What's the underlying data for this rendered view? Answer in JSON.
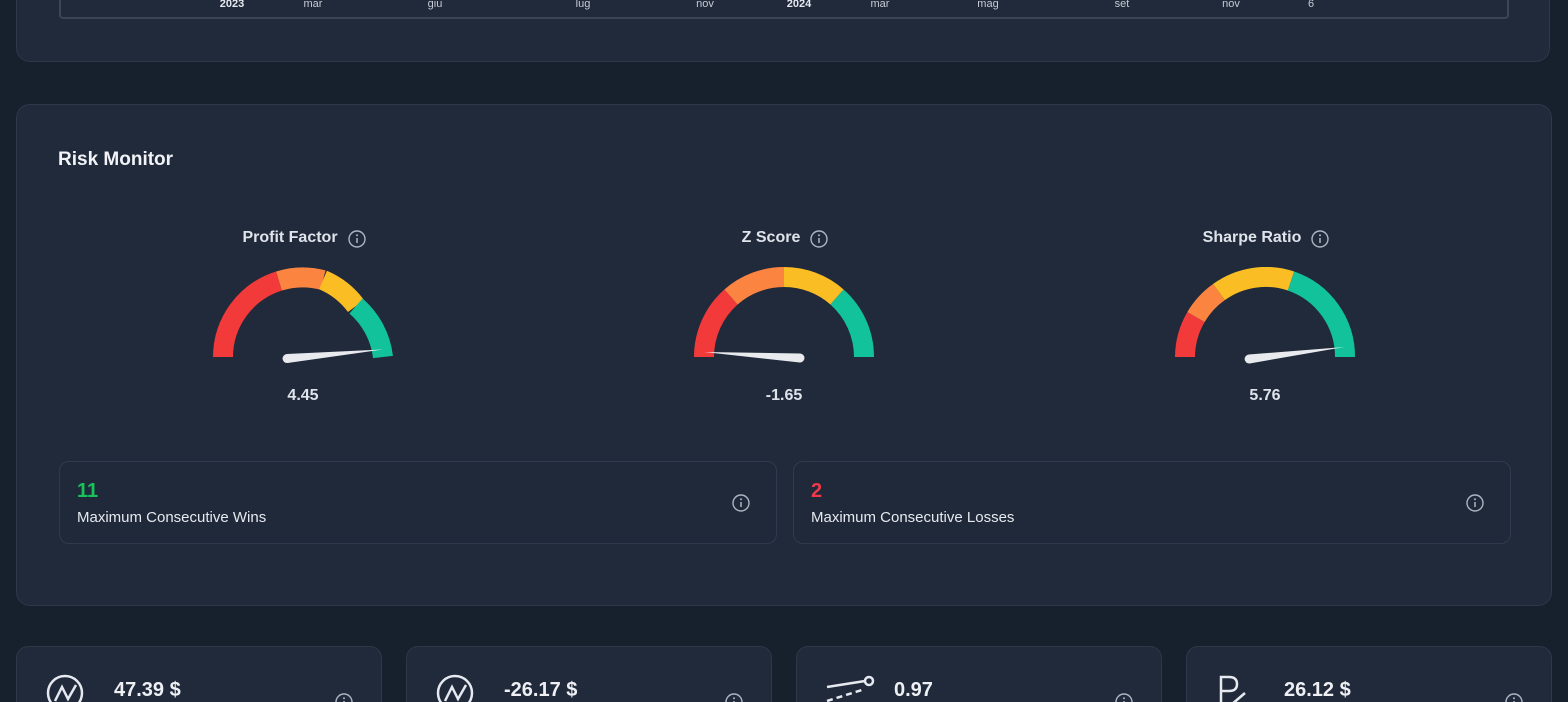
{
  "timeline": {
    "ticks": [
      {
        "label": "2023",
        "bold": true
      },
      {
        "label": "mar",
        "bold": false
      },
      {
        "label": "giu",
        "bold": false
      },
      {
        "label": "lug",
        "bold": false
      },
      {
        "label": "nov",
        "bold": false
      },
      {
        "label": "2024",
        "bold": true
      },
      {
        "label": "mar",
        "bold": false
      },
      {
        "label": "mag",
        "bold": false
      },
      {
        "label": "set",
        "bold": false
      },
      {
        "label": "nov",
        "bold": false
      },
      {
        "label": "6",
        "bold": false
      }
    ]
  },
  "risk_monitor": {
    "title": "Risk Monitor",
    "gauges": [
      {
        "label": "Profit Factor",
        "value": "4.45",
        "needle_fraction": 0.97
      },
      {
        "label": "Z Score",
        "value": "-1.65",
        "needle_fraction": 0.02
      },
      {
        "label": "Sharpe Ratio",
        "value": "5.76",
        "needle_fraction": 0.96
      }
    ],
    "streaks": {
      "wins": {
        "value": "11",
        "label": "Maximum Consecutive Wins"
      },
      "losses": {
        "value": "2",
        "label": "Maximum Consecutive Losses"
      }
    }
  },
  "stats": [
    {
      "value": "47.39 $",
      "icon": "average-win-icon"
    },
    {
      "value": "-26.17 $",
      "icon": "average-loss-icon"
    },
    {
      "value": "0.97",
      "icon": "trend-line-icon"
    },
    {
      "value": "26.12 $",
      "icon": "payoff-icon"
    }
  ],
  "colors": {
    "red": "#f23a3a",
    "orange": "#fb8540",
    "yellow": "#fbbd24",
    "green": "#12c29b",
    "win": "#19c25a",
    "loss": "#f0384a"
  }
}
